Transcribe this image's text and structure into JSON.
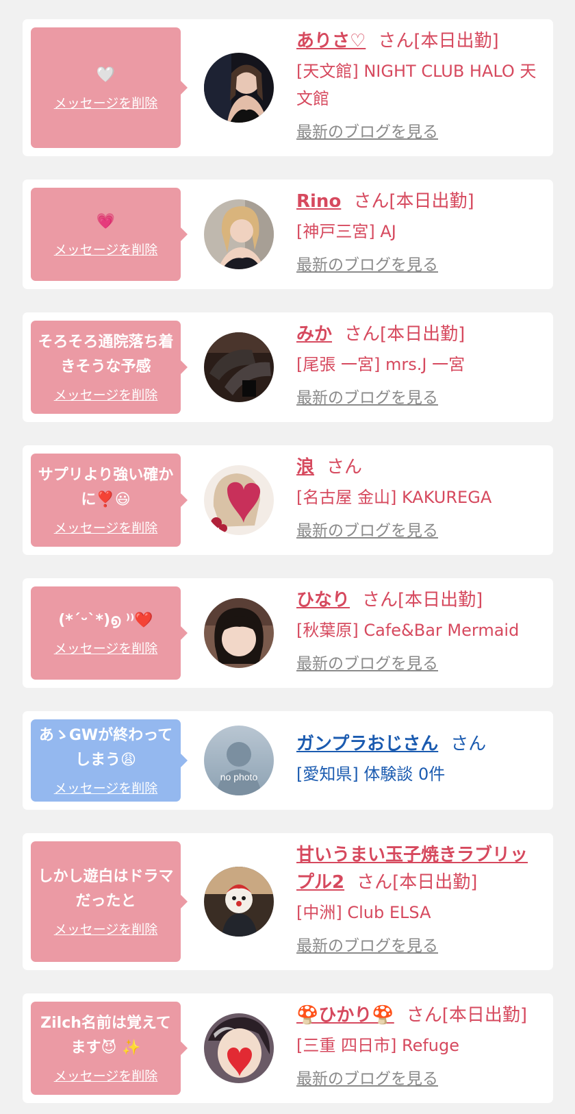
{
  "cards": [
    {
      "message": "🤍",
      "delete_label": "メッセージを削除",
      "name": "ありさ♡",
      "suffix": "さん[本日出勤]",
      "shop": "[天文館] NIGHT CLUB HALO 天文館",
      "blog_label": "最新のブログを見る",
      "avatar": "photo-girl-dark-bg"
    },
    {
      "message": "💗",
      "delete_label": "メッセージを削除",
      "name": "Rino",
      "suffix": "さん[本日出勤]",
      "shop": "[神戸三宮] AJ",
      "blog_label": "最新のブログを見る",
      "avatar": "photo-girl-blonde"
    },
    {
      "message": "そろそろ通院落ち着きそうな予感",
      "delete_label": "メッセージを削除",
      "name": "みか",
      "suffix": "さん[本日出勤]",
      "shop": "[尾張 一宮] mrs.J 一宮",
      "blog_label": "最新のブログを見る",
      "avatar": "photo-legs-stockings"
    },
    {
      "message": "サプリより強い確かに❣️😃",
      "delete_label": "メッセージを削除",
      "name": "浪",
      "suffix": "さん",
      "shop": "[名古屋 金山] KAKUREGA",
      "blog_label": "最新のブログを見る",
      "avatar": "photo-heart-sticker"
    },
    {
      "message": "(*´ᵕ`*)൭ ⁾⁾❤️",
      "delete_label": "メッセージを削除",
      "name": "ひなり",
      "suffix": "さん[本日出勤]",
      "shop": "[秋葉原] Cafe&Bar Mermaid",
      "blog_label": "最新のブログを見る",
      "avatar": "photo-girl-bangs"
    },
    {
      "message": "あゝGWが終わってしまう😩",
      "delete_label": "メッセージを削除",
      "name": "ガンプラおじさん",
      "suffix": "さん",
      "shop": "[愛知県] 体験談 0件",
      "blog_label": "",
      "avatar": "no-photo",
      "no_photo_label": "no photo"
    },
    {
      "message": "しかし遊白はドラマだったと",
      "delete_label": "メッセージを削除",
      "name": "甘いうまい玉子焼きラブリップル2",
      "suffix": "さん[本日出勤]",
      "shop": "[中洲] Club ELSA",
      "blog_label": "最新のブログを見る",
      "avatar": "photo-mask-character"
    },
    {
      "message": "Zilch名前は覚えてます😈 ✨",
      "delete_label": "メッセージを削除",
      "name": "🍄ひかり🍄",
      "suffix": "さん[本日出勤]",
      "shop": "[三重 四日市] Refuge",
      "blog_label": "最新のブログを見る",
      "avatar": "photo-heart-face"
    }
  ],
  "colors": {
    "pink_bubble": "#eb9aa4",
    "blue_bubble": "#94b8ef",
    "pink_text": "#d6495e",
    "blue_text": "#1b5bb0",
    "gray_link": "#8a8a8a"
  }
}
